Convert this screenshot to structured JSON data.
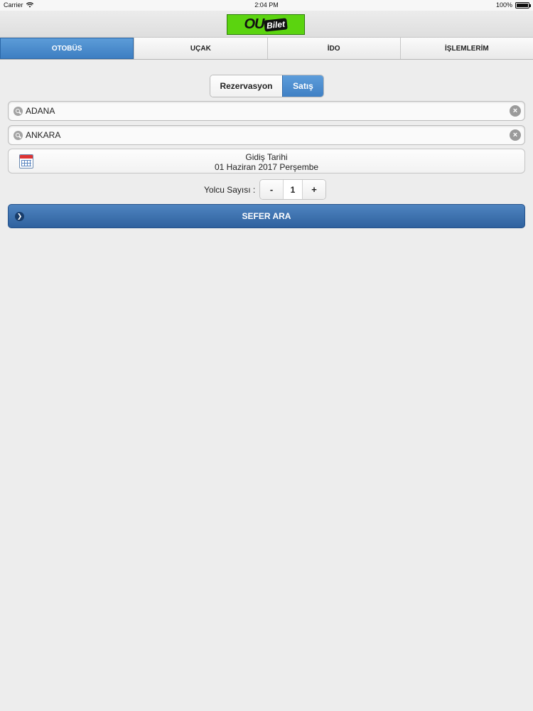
{
  "status_bar": {
    "carrier": "Carrier",
    "time": "2:04 PM",
    "battery": "100%"
  },
  "header": {
    "logo_ou": "OU",
    "logo_bilet": "Bilet"
  },
  "tabs": [
    {
      "label": "OTOBÜS",
      "active": true
    },
    {
      "label": "UÇAK",
      "active": false
    },
    {
      "label": "İDO",
      "active": false
    },
    {
      "label": "İŞLEMLERİM",
      "active": false
    }
  ],
  "segment": {
    "reservation_label": "Rezervasyon",
    "sale_label": "Satış",
    "selected": "Satış"
  },
  "from_field": {
    "value": "ADANA"
  },
  "to_field": {
    "value": "ANKARA"
  },
  "departure": {
    "label": "Gidiş Tarihi",
    "date": "01 Haziran 2017 Perşembe"
  },
  "passengers": {
    "label": "Yolcu Sayısı :",
    "minus": "-",
    "count": "1",
    "plus": "+"
  },
  "search_button": {
    "label": "SEFER ARA"
  },
  "colors": {
    "accent_blue": "#3d7ec2",
    "button_blue": "#2f619e",
    "logo_green": "#5bd40f",
    "background": "#ededed"
  },
  "icons": [
    "wifi-icon",
    "battery-icon",
    "search-icon",
    "clear-icon",
    "calendar-icon",
    "chevron-right-icon"
  ]
}
